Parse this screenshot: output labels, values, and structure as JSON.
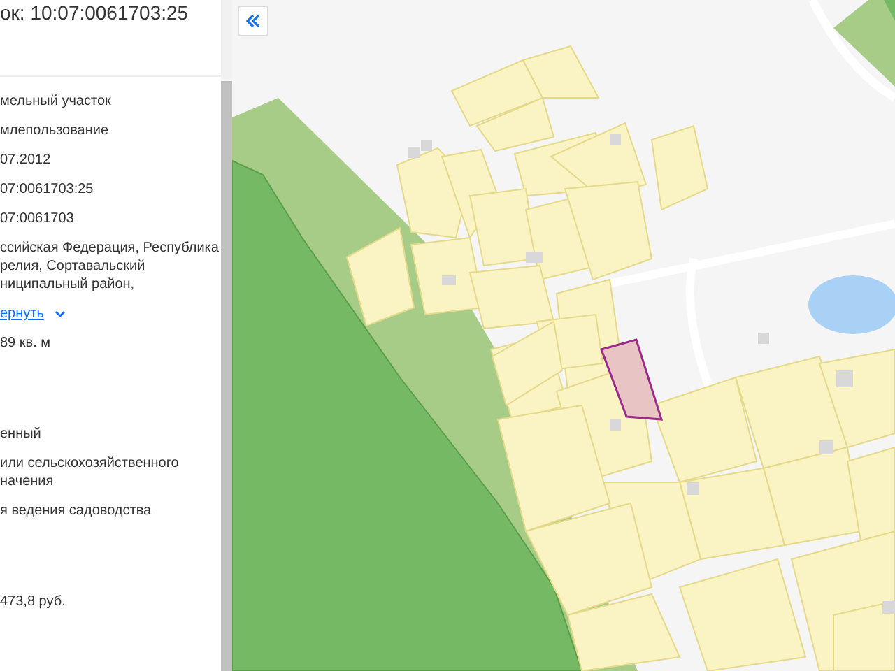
{
  "panel": {
    "title": "ок: 10:07:0061703:25",
    "fields": [
      {
        "kind": "text",
        "lines": [
          "мельный участок"
        ]
      },
      {
        "kind": "text",
        "lines": [
          "млепользование"
        ]
      },
      {
        "kind": "text",
        "lines": [
          "07.2012"
        ]
      },
      {
        "kind": "text",
        "lines": [
          "07:0061703:25"
        ]
      },
      {
        "kind": "text",
        "lines": [
          "07:0061703"
        ]
      },
      {
        "kind": "text",
        "lines": [
          "ссийская Федерация, Республика",
          "релия, Сортавальский",
          "ниципальный район,"
        ]
      },
      {
        "kind": "link",
        "lines": [
          "ернуть"
        ]
      },
      {
        "kind": "text",
        "lines": [
          "89 кв. м"
        ]
      },
      {
        "kind": "gap"
      },
      {
        "kind": "text",
        "lines": [
          "енный"
        ]
      },
      {
        "kind": "text",
        "lines": [
          "или сельскохозяйственного",
          "начения"
        ]
      },
      {
        "kind": "text",
        "lines": [
          "я ведения садоводства"
        ]
      },
      {
        "kind": "gap"
      },
      {
        "kind": "text",
        "lines": [
          "473,8 руб."
        ]
      }
    ]
  }
}
